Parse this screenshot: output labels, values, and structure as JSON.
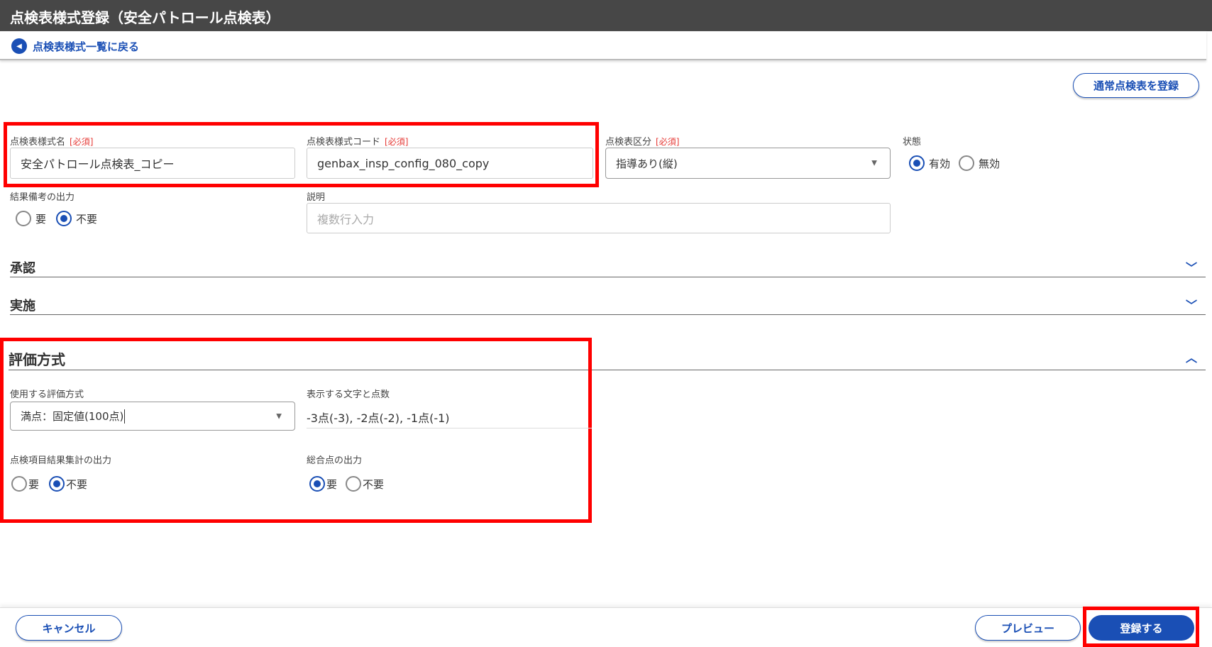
{
  "header": {
    "title": "点検表様式登録（安全パトロール点検表）"
  },
  "nav": {
    "back_label": "点検表様式一覧に戻る"
  },
  "actions": {
    "register_normal": "通常点検表を登録"
  },
  "form": {
    "name": {
      "label": "点検表様式名",
      "required": "[必須]",
      "value": "安全パトロール点検表_コピー"
    },
    "code": {
      "label": "点検表様式コード",
      "required": "[必須]",
      "value": "genbax_insp_config_080_copy"
    },
    "category": {
      "label": "点検表区分",
      "required": "[必須]",
      "value": "指導あり(縦)"
    },
    "status": {
      "label": "状態",
      "options": [
        "有効",
        "無効"
      ],
      "selected": "有効"
    },
    "remarks_output": {
      "label": "結果備考の出力",
      "options": [
        "要",
        "不要"
      ],
      "selected": "不要"
    },
    "description": {
      "label": "説明",
      "placeholder": "複数行入力"
    }
  },
  "sections": {
    "approval": "承認",
    "execution": "実施",
    "evaluation": "評価方式"
  },
  "evaluation": {
    "method": {
      "label": "使用する評価方式",
      "value": "満点：固定値(100点)"
    },
    "display": {
      "label": "表示する文字と点数",
      "value": "-3点(-3), -2点(-2), -1点(-1)"
    },
    "item_summary": {
      "label": "点検項目結果集計の出力",
      "options": [
        "要",
        "不要"
      ],
      "selected": "不要"
    },
    "total_score": {
      "label": "総合点の出力",
      "options": [
        "要",
        "不要"
      ],
      "selected": "要"
    }
  },
  "footer": {
    "cancel": "キャンセル",
    "preview": "プレビュー",
    "register": "登録する"
  },
  "colors": {
    "accent": "#1a4fb5",
    "header": "#474747",
    "highlight": "#ff0000"
  }
}
